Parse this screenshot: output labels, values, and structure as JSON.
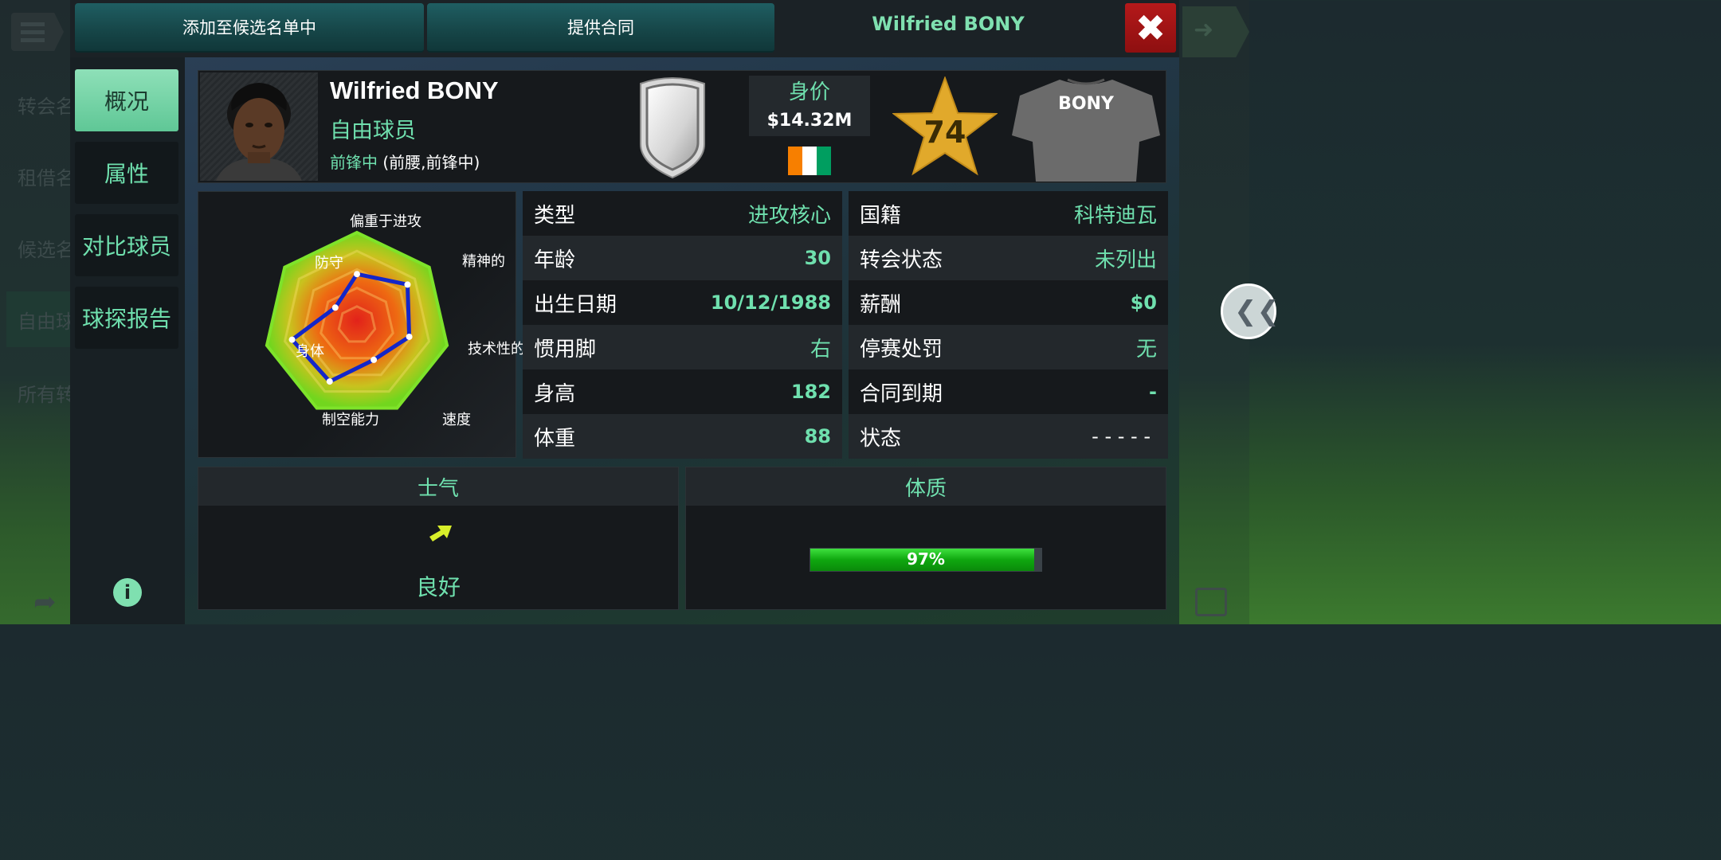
{
  "background": {
    "side_items": [
      "转会名",
      "租借名",
      "候选名",
      "自由球",
      "所有转"
    ]
  },
  "topbar": {
    "add_shortlist_label": "添加至候选名单中",
    "offer_contract_label": "提供合同",
    "title": "Wilfried BONY"
  },
  "sidebar": {
    "tabs": [
      {
        "label": "概况",
        "active": true
      },
      {
        "label": "属性",
        "active": false
      },
      {
        "label": "对比球员",
        "active": false
      },
      {
        "label": "球探报告",
        "active": false
      }
    ]
  },
  "player": {
    "name": "Wilfried BONY",
    "status": "自由球员",
    "position": "前锋中",
    "alt_positions": "(前腰,前锋中)",
    "value_label": "身价",
    "value": "$14.32M",
    "rating": "74",
    "shirt_name": "BONY",
    "flag_colors": [
      "#f77f00",
      "#ffffff",
      "#009e60"
    ]
  },
  "radar": {
    "axes": [
      "偏重于进攻",
      "精神的",
      "技术性的",
      "速度",
      "制空能力",
      "身体",
      "防守"
    ],
    "values": [
      0.55,
      0.7,
      0.58,
      0.42,
      0.68,
      0.72,
      0.3
    ]
  },
  "info_left": [
    {
      "key": "类型",
      "value": "进攻核心"
    },
    {
      "key": "年龄",
      "value": "30"
    },
    {
      "key": "出生日期",
      "value": "10/12/1988"
    },
    {
      "key": "惯用脚",
      "value": "右"
    },
    {
      "key": "身高",
      "value": "182"
    },
    {
      "key": "体重",
      "value": "88"
    }
  ],
  "info_right": [
    {
      "key": "国籍",
      "value": "科特迪瓦"
    },
    {
      "key": "转会状态",
      "value": "未列出"
    },
    {
      "key": "薪酬",
      "value": "$0"
    },
    {
      "key": "停赛处罚",
      "value": "无"
    },
    {
      "key": "合同到期",
      "value": "-"
    },
    {
      "key": "状态",
      "value": "- - - - -"
    }
  ],
  "morale": {
    "title": "士气",
    "value": "良好"
  },
  "fitness": {
    "title": "体质",
    "value": "97%",
    "level": 0.97
  }
}
